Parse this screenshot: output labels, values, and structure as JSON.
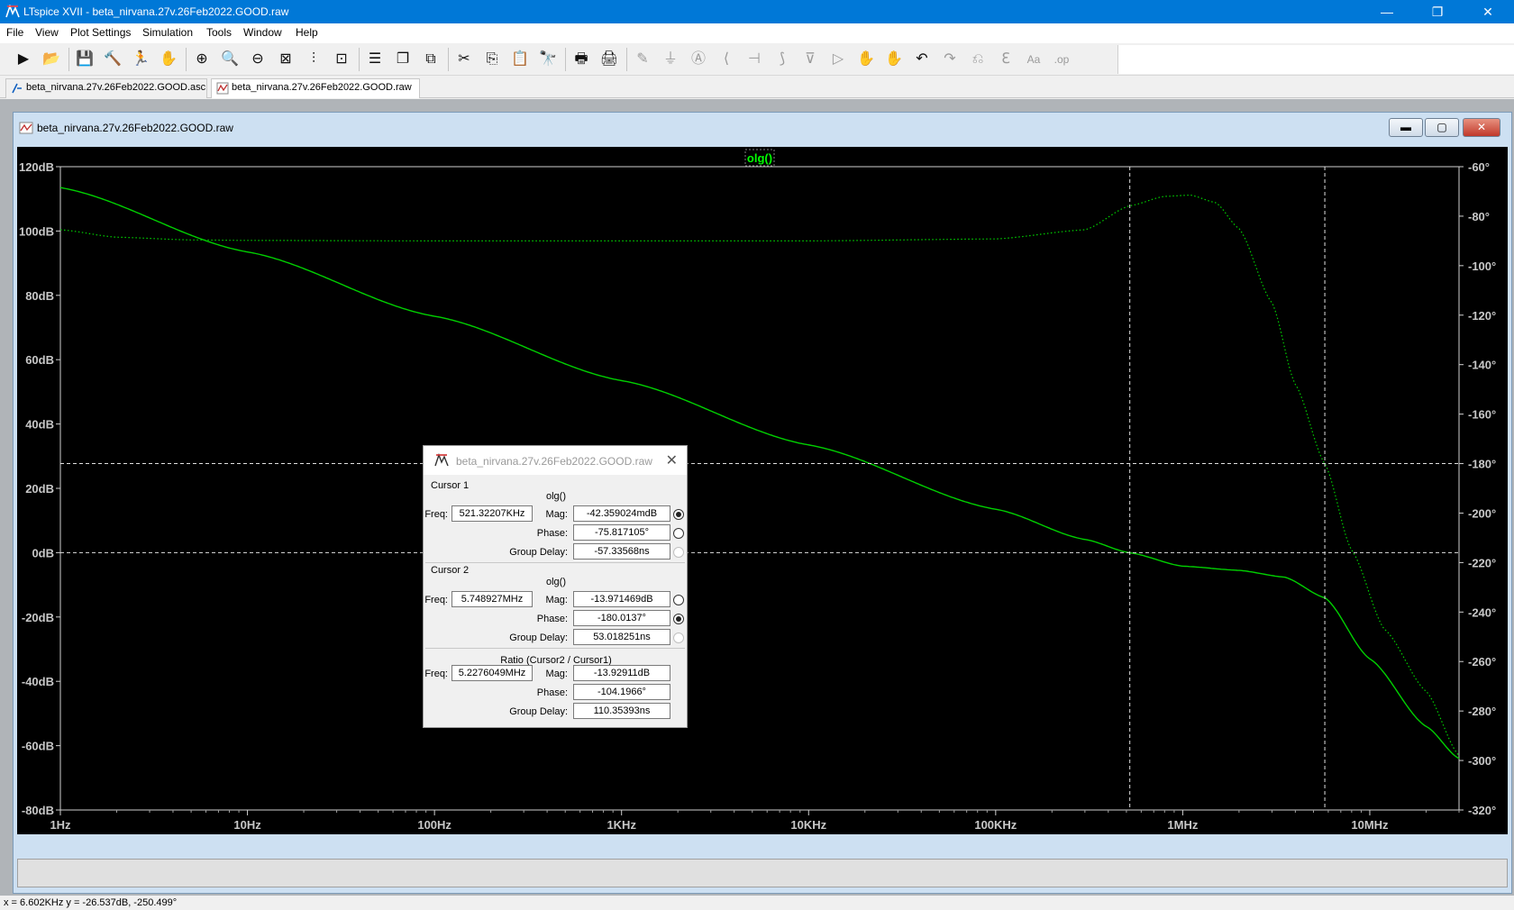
{
  "window": {
    "title": "LTspice XVII - beta_nirvana.27v.26Feb2022.GOOD.raw",
    "controls": {
      "minimize": "—",
      "restore": "❐",
      "close": "✕"
    }
  },
  "menu": [
    "File",
    "View",
    "Plot Settings",
    "Simulation",
    "Tools",
    "Window",
    "Help"
  ],
  "toolbar": [
    {
      "name": "run-icon",
      "glyph": "▶"
    },
    {
      "name": "open-icon",
      "glyph": "📂"
    },
    {
      "name": "save-icon",
      "glyph": "💾"
    },
    {
      "name": "control-panel-icon",
      "glyph": "🔨"
    },
    {
      "name": "halt-icon",
      "glyph": "🏃"
    },
    {
      "name": "pan-icon",
      "glyph": "✋"
    },
    {
      "name": "zoom-in-icon",
      "glyph": "⊕"
    },
    {
      "name": "zoom-area-icon",
      "glyph": "🔍"
    },
    {
      "name": "zoom-out-icon",
      "glyph": "⊖"
    },
    {
      "name": "zoom-fit-icon",
      "glyph": "⊠"
    },
    {
      "name": "autorange-icon",
      "glyph": "⫶"
    },
    {
      "name": "zoom-extents-icon",
      "glyph": "⊡"
    },
    {
      "name": "tile-horizontal-icon",
      "glyph": "☰"
    },
    {
      "name": "cascade-icon",
      "glyph": "❐"
    },
    {
      "name": "tile-vertical-icon",
      "glyph": "⧉"
    },
    {
      "name": "cut-icon",
      "glyph": "✂"
    },
    {
      "name": "copy-icon",
      "glyph": "⎘"
    },
    {
      "name": "paste-icon",
      "glyph": "📋"
    },
    {
      "name": "find-icon",
      "glyph": "🔭"
    },
    {
      "name": "print-icon",
      "glyph": "🖶"
    },
    {
      "name": "print-setup-icon",
      "glyph": "🖨"
    },
    {
      "name": "wire-icon",
      "glyph": "✎",
      "dim": true
    },
    {
      "name": "ground-icon",
      "glyph": "⏚",
      "dim": true
    },
    {
      "name": "label-icon",
      "glyph": "Ⓐ",
      "dim": true
    },
    {
      "name": "resistor-icon",
      "glyph": "⟨",
      "dim": true
    },
    {
      "name": "capacitor-icon",
      "glyph": "⊣",
      "dim": true
    },
    {
      "name": "inductor-icon",
      "glyph": "⟆",
      "dim": true
    },
    {
      "name": "diode-icon",
      "glyph": "⊽",
      "dim": true
    },
    {
      "name": "component-icon",
      "glyph": "▷",
      "dim": true
    },
    {
      "name": "move-icon",
      "glyph": "✋",
      "dim": true
    },
    {
      "name": "drag-icon",
      "glyph": "✋",
      "dim": true
    },
    {
      "name": "undo-icon",
      "glyph": "↶"
    },
    {
      "name": "redo-icon",
      "glyph": "↷",
      "dim": true
    },
    {
      "name": "rotate-icon",
      "glyph": "⎌",
      "dim": true
    },
    {
      "name": "mirror-icon",
      "glyph": "ℇ",
      "dim": true
    },
    {
      "name": "text-icon",
      "glyph": "Aa",
      "dim": true
    },
    {
      "name": "spice-directive-icon",
      "glyph": ".op",
      "dim": true
    }
  ],
  "tabs": [
    {
      "label": "beta_nirvana.27v.26Feb2022.GOOD.asc",
      "active": false
    },
    {
      "label": "beta_nirvana.27v.26Feb2022.GOOD.raw",
      "active": true
    }
  ],
  "plot_window": {
    "title": "beta_nirvana.27v.26Feb2022.GOOD.raw",
    "controls": {
      "minimize": "▬",
      "restore": "▢",
      "close": "✕"
    }
  },
  "chart_data": {
    "type": "line",
    "trace_name": "olg()",
    "x_scale": "log",
    "xlim_hz": [
      1,
      30000000
    ],
    "x_ticks": [
      {
        "value": 1,
        "label": "1Hz"
      },
      {
        "value": 10,
        "label": "10Hz"
      },
      {
        "value": 100,
        "label": "100Hz"
      },
      {
        "value": 1000,
        "label": "1KHz"
      },
      {
        "value": 10000,
        "label": "10KHz"
      },
      {
        "value": 100000,
        "label": "100KHz"
      },
      {
        "value": 1000000,
        "label": "1MHz"
      },
      {
        "value": 10000000,
        "label": "10MHz"
      }
    ],
    "ylim_db": [
      -80,
      120
    ],
    "y_ticks": [
      "120dB",
      "100dB",
      "80dB",
      "60dB",
      "40dB",
      "20dB",
      "0dB",
      "-20dB",
      "-40dB",
      "-60dB",
      "-80dB"
    ],
    "y_tick_values": [
      120,
      100,
      80,
      60,
      40,
      20,
      0,
      -20,
      -40,
      -60,
      -80
    ],
    "y2lim_deg": [
      -320,
      -60
    ],
    "y2_ticks": [
      "-60°",
      "-80°",
      "-100°",
      "-120°",
      "-140°",
      "-160°",
      "-180°",
      "-200°",
      "-220°",
      "-240°",
      "-260°",
      "-280°",
      "-300°",
      "-320°"
    ],
    "y2_tick_values": [
      -60,
      -80,
      -100,
      -120,
      -140,
      -160,
      -180,
      -200,
      -220,
      -240,
      -260,
      -280,
      -300,
      -320
    ],
    "grid": false,
    "trace_color": "#00d000",
    "magnitude_db": {
      "x": [
        1,
        10,
        100,
        1000,
        10000,
        100000,
        300000,
        521322,
        1000000,
        2000000,
        3500000,
        5748927,
        10000000,
        20000000,
        30000000
      ],
      "y": [
        113.5,
        93.5,
        73.5,
        53.5,
        33.5,
        13.5,
        4.1,
        -0.04,
        -4.2,
        -5.5,
        -7.6,
        -14.0,
        -33.0,
        -54.0,
        -64.0
      ]
    },
    "phase_deg": {
      "x": [
        1,
        2,
        5,
        10,
        100,
        1000,
        10000,
        100000,
        300000,
        521322,
        800000,
        1100000,
        1500000,
        2000000,
        3000000,
        4000000,
        5748927,
        8000000,
        12000000,
        20000000,
        30000000
      ],
      "y": [
        -85.5,
        -88.5,
        -89.6,
        -89.8,
        -90.0,
        -90.0,
        -90.0,
        -89.2,
        -85.5,
        -75.8,
        -72.0,
        -71.5,
        -74.5,
        -85.0,
        -115.0,
        -148.0,
        -180.0,
        -215.0,
        -247.0,
        -272.0,
        -298.0
      ]
    },
    "cursor1": {
      "freq_hz": 521322,
      "mag_db": 0,
      "marker": "mag"
    },
    "cursor2": {
      "freq_hz": 5748927,
      "phase_deg": -180,
      "marker": "phase"
    }
  },
  "cursor_dialog": {
    "title": "beta_nirvana.27v.26Feb2022.GOOD.raw",
    "close": "✕",
    "cursor1": {
      "heading": "Cursor 1",
      "trace": "olg()",
      "freq_label": "Freq:",
      "freq": "521.32207KHz",
      "mag_label": "Mag:",
      "mag": "-42.359024mdB",
      "phase_label": "Phase:",
      "phase": "-75.817105°",
      "gd_label": "Group Delay:",
      "group_delay": "-57.33568ns"
    },
    "cursor2": {
      "heading": "Cursor 2",
      "trace": "olg()",
      "freq_label": "Freq:",
      "freq": "5.748927MHz",
      "mag_label": "Mag:",
      "mag": "-13.971469dB",
      "phase_label": "Phase:",
      "phase": "-180.0137°",
      "gd_label": "Group Delay:",
      "group_delay": "53.018251ns"
    },
    "ratio": {
      "heading": "Ratio (Cursor2 / Cursor1)",
      "freq_label": "Freq:",
      "freq": "5.2276049MHz",
      "mag_label": "Mag:",
      "mag": "-13.92911dB",
      "phase_label": "Phase:",
      "phase": "-104.1966°",
      "gd_label": "Group Delay:",
      "group_delay": "110.35393ns"
    }
  },
  "status": "x = 6.602KHz    y = -26.537dB, -250.499°"
}
